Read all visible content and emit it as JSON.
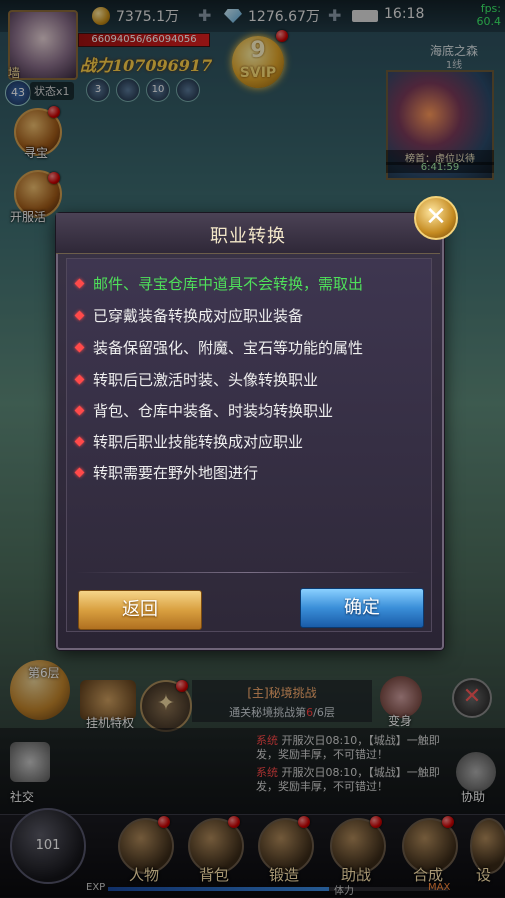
{
  "topbar": {
    "gold": "7375.1万",
    "diamonds": "1276.67万",
    "time": "16:18",
    "fps_label": "fps:",
    "fps_value": "60.4"
  },
  "player": {
    "hp": "66094056/66094056",
    "power": "战力107096917",
    "level": "43",
    "status": "状态x1",
    "name_char": "墙",
    "buffs": [
      "3",
      "",
      "10",
      ""
    ],
    "svip_level": "9",
    "svip_label": "SVIP"
  },
  "minimap": {
    "title": "海底之森",
    "line": "1线",
    "rank_label": "榜首：虚位以待",
    "rank_timer": "6:41:59"
  },
  "side_buttons": {
    "treasure": "寻宝",
    "opening": "开服活"
  },
  "dialog": {
    "title": "职业转换",
    "rules": [
      {
        "text": "邮件、寻宝仓库中道具不会转换，需取出",
        "highlight": true
      },
      {
        "text": "已穿戴装备转换成对应职业装备",
        "highlight": false
      },
      {
        "text": "装备保留强化、附魔、宝石等功能的属性",
        "highlight": false
      },
      {
        "text": "转职后已激活时装、头像转换职业",
        "highlight": false
      },
      {
        "text": "背包、仓库中装备、时装均转换职业",
        "highlight": false
      },
      {
        "text": "转职后职业技能转换成对应职业",
        "highlight": false
      },
      {
        "text": "转职需要在野外地图进行",
        "highlight": false
      }
    ],
    "back_label": "返回",
    "confirm_label": "确定",
    "close_symbol": "✕"
  },
  "hud": {
    "floor": "第6层",
    "auto_privilege": "挂机特权",
    "quest_title": "[主]秘境挑战",
    "quest_desc_prefix": "通关秘境挑战第",
    "quest_desc_value": "6",
    "quest_desc_suffix": "/6层",
    "boss": "变身",
    "social": "社交",
    "assist": "协助"
  },
  "chat": [
    "开服次日08:10，【城战】一触即发，奖励丰厚，不可错过！",
    "开服次日08:10，【城战】一触即发，奖励丰厚，不可错过！"
  ],
  "chat_tag": "系统",
  "bottom_nav": {
    "orb_level": "101",
    "items": [
      "人物",
      "背包",
      "锻造",
      "助战",
      "合成",
      "设"
    ],
    "exp_label": "EXP",
    "stamina_label": "体力",
    "max_label": "MAX",
    "exp_progress": 0.65
  },
  "colors": {
    "highlight_text": "#4fe05a",
    "bullet": "#ff4a4a",
    "back_button": "#d9a040",
    "confirm_button": "#3a8ed8"
  }
}
